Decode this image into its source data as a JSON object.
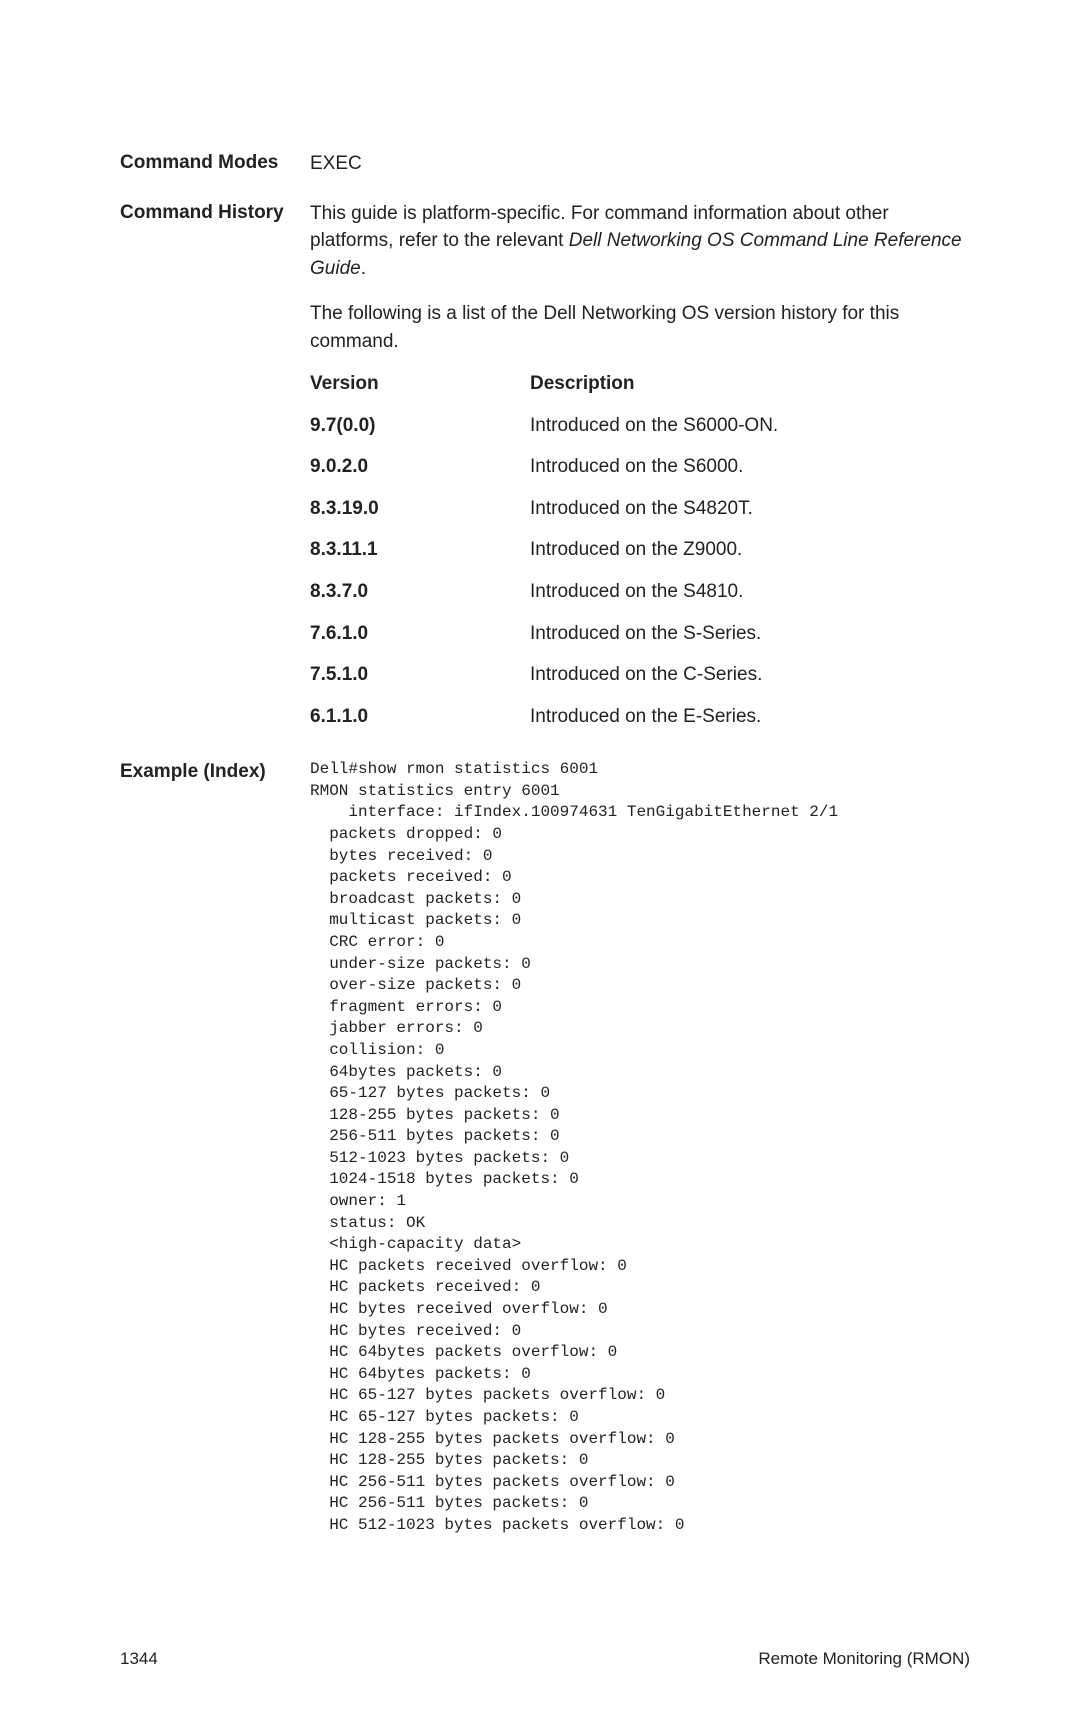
{
  "sections": {
    "commandModes": {
      "label": "Command Modes",
      "value": "EXEC"
    },
    "commandHistory": {
      "label": "Command History",
      "para1_pre": "This guide is platform-specific. For command information about other platforms, refer to the relevant ",
      "para1_italic": "Dell Networking OS Command Line Reference Guide",
      "para1_post": ".",
      "para2": "The following is a list of the Dell Networking OS version history for this command.",
      "headers": {
        "version": "Version",
        "description": "Description"
      },
      "rows": [
        {
          "v": "9.7(0.0)",
          "d": "Introduced on the S6000-ON."
        },
        {
          "v": "9.0.2.0",
          "d": "Introduced on the S6000."
        },
        {
          "v": "8.3.19.0",
          "d": "Introduced on the S4820T."
        },
        {
          "v": "8.3.11.1",
          "d": "Introduced on the Z9000."
        },
        {
          "v": "8.3.7.0",
          "d": "Introduced on the S4810."
        },
        {
          "v": "7.6.1.0",
          "d": "Introduced on the S-Series."
        },
        {
          "v": "7.5.1.0",
          "d": "Introduced on the C-Series."
        },
        {
          "v": "6.1.1.0",
          "d": "Introduced on the E-Series."
        }
      ]
    },
    "example": {
      "label": "Example (Index)",
      "code": "Dell#show rmon statistics 6001\nRMON statistics entry 6001\n    interface: ifIndex.100974631 TenGigabitEthernet 2/1\n  packets dropped: 0\n  bytes received: 0\n  packets received: 0\n  broadcast packets: 0\n  multicast packets: 0\n  CRC error: 0\n  under-size packets: 0\n  over-size packets: 0\n  fragment errors: 0\n  jabber errors: 0\n  collision: 0\n  64bytes packets: 0\n  65-127 bytes packets: 0\n  128-255 bytes packets: 0\n  256-511 bytes packets: 0\n  512-1023 bytes packets: 0\n  1024-1518 bytes packets: 0\n  owner: 1\n  status: OK\n  <high-capacity data>\n  HC packets received overflow: 0\n  HC packets received: 0\n  HC bytes received overflow: 0\n  HC bytes received: 0\n  HC 64bytes packets overflow: 0\n  HC 64bytes packets: 0\n  HC 65-127 bytes packets overflow: 0\n  HC 65-127 bytes packets: 0\n  HC 128-255 bytes packets overflow: 0\n  HC 128-255 bytes packets: 0\n  HC 256-511 bytes packets overflow: 0\n  HC 256-511 bytes packets: 0\n  HC 512-1023 bytes packets overflow: 0"
    }
  },
  "footer": {
    "page": "1344",
    "title": "Remote Monitoring (RMON)"
  }
}
